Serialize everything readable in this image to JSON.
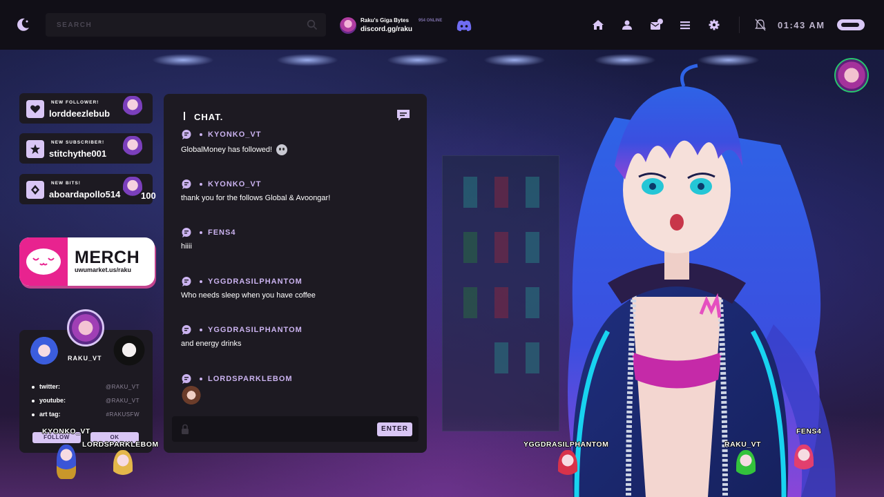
{
  "topbar": {
    "search_placeholder": "SEARCH",
    "discord": {
      "server_name": "Raku's Giga Bytes",
      "online": "954 ONLINE",
      "link": "discord.gg/raku"
    },
    "nav_icons": [
      "home-icon",
      "user-icon",
      "mail-icon",
      "menu-icon",
      "settings-icon"
    ],
    "mail_badge": "0",
    "time": "01:43 AM"
  },
  "alerts": [
    {
      "type": "NEW FOLLOWER!",
      "user": "lorddeezlebub",
      "icon": "heart-icon"
    },
    {
      "type": "NEW SUBSCRIBER!",
      "user": "stitchythe001",
      "icon": "star-icon"
    },
    {
      "type": "NEW BITS!",
      "user": "aboardapollo514",
      "amount": "100",
      "icon": "diamond-icon"
    }
  ],
  "merch": {
    "title": "MERCH",
    "url": "uwumarket.us/raku"
  },
  "profile": {
    "name": "RAKU_VT",
    "socials": [
      {
        "label": "twitter:",
        "value": "@RAKU_VT"
      },
      {
        "label": "youtube:",
        "value": "@RAKU_VT"
      },
      {
        "label": "art tag:",
        "value": "#RAKUSFW"
      }
    ],
    "follow_label": "FOLLOW",
    "ok_label": "OK"
  },
  "chat": {
    "title": "CHAT.",
    "messages": [
      {
        "user": "KYONKO_VT",
        "text": "GlobalMoney has followed!"
      },
      {
        "user": "KYONKO_VT",
        "text": "thank you for the follows Global & Avoongar!"
      },
      {
        "user": "FENS4",
        "text": "hiiii"
      },
      {
        "user": "YGGDRASILPHANTOM",
        "text": "Who needs sleep when you have coffee"
      },
      {
        "user": "YGGDRASILPHANTOM",
        "text": "and energy drinks"
      },
      {
        "user": "LORDSPARKLEBOM",
        "text": ""
      }
    ],
    "input_value": "",
    "enter_label": "ENTER"
  },
  "onscreen_chatters": [
    {
      "name": "KYONKO_VT",
      "color": "#3b55d6"
    },
    {
      "name": "LORDSPARKLEBOM",
      "color": "#e4b74a"
    },
    {
      "name": "YGGDRASILPHANTOM",
      "color": "#d8324a"
    },
    {
      "name": "RAKU_VT",
      "color": "#33c23c"
    },
    {
      "name": "FENS4",
      "color": "#e23f6e"
    }
  ],
  "colors": {
    "accent": "#d9c6f5",
    "panel": "#1d1a22",
    "topbar": "#110f17",
    "merch_pink": "#e8238f"
  }
}
